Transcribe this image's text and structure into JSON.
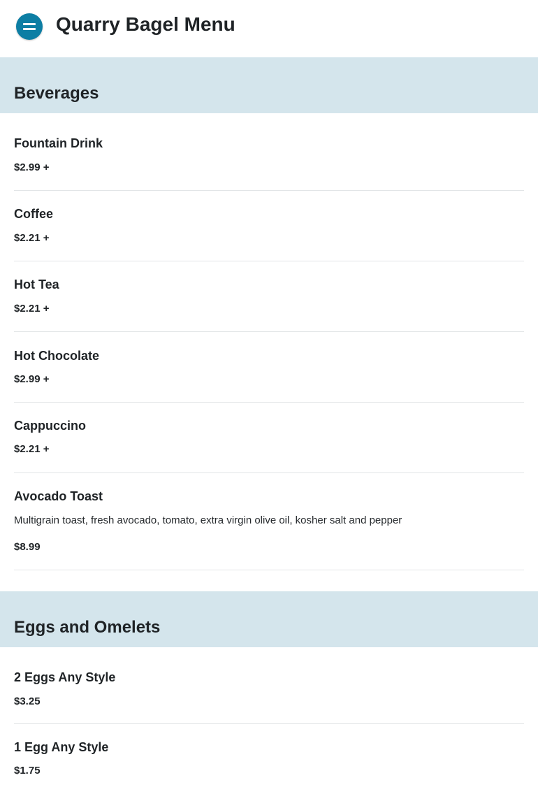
{
  "header": {
    "title": "Quarry Bagel Menu",
    "menu_icon": "menu-icon",
    "accent_color": "#0d7ea4"
  },
  "sections": [
    {
      "title": "Beverages",
      "items": [
        {
          "name": "Fountain Drink",
          "price": "$2.99 +"
        },
        {
          "name": "Coffee",
          "price": "$2.21 +"
        },
        {
          "name": "Hot Tea",
          "price": "$2.21 +"
        },
        {
          "name": "Hot Chocolate",
          "price": "$2.99 +"
        },
        {
          "name": "Cappuccino",
          "price": "$2.21 +"
        },
        {
          "name": "Avocado Toast",
          "description": "Multigrain toast, fresh avocado, tomato, extra virgin olive oil, kosher salt and pepper",
          "price": "$8.99"
        }
      ]
    },
    {
      "title": "Eggs and Omelets",
      "items": [
        {
          "name": "2 Eggs Any Style",
          "price": "$3.25"
        },
        {
          "name": "1 Egg Any Style",
          "price": "$1.75"
        }
      ]
    }
  ],
  "section_bg_color": "#d4e5ec"
}
